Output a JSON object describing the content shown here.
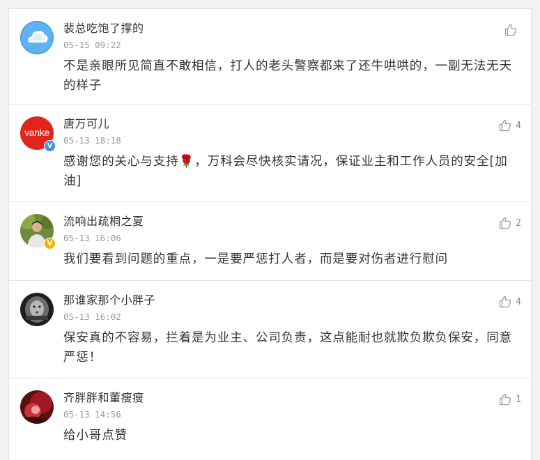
{
  "comments": [
    {
      "username": "裴总吃饱了撑的",
      "time": "05-15 09:22",
      "text": "不是亲眼所见简直不敢相信，打人的老头警察都来了还牛哄哄的，一副无法无天的样子",
      "likes": "",
      "avatar": "cloud-avatar",
      "verified": false
    },
    {
      "username": "唐万可儿",
      "time": "05-13 18:18",
      "text": "感谢您的关心与支持🌹，万科会尽快核实请况，保证业主和工作人员的安全[加油]",
      "likes": "4",
      "avatar": "vanke-logo-avatar",
      "avatar_text": "vanke",
      "verified": true,
      "verified_color": "#3f8ee8"
    },
    {
      "username": "流响出疏桐之夏",
      "time": "05-13 16:06",
      "text": "我们要看到问题的重点，一是要严惩打人者，而是要对伤者进行慰问",
      "likes": "2",
      "avatar": "person-photo-avatar",
      "verified": true,
      "verified_color": "#f5b400"
    },
    {
      "username": "那谁家那个小胖子",
      "time": "05-13 16:02",
      "text": "保安真的不容易，拦着是为业主、公司负责，这点能耐也就欺负欺负保安，同意严惩！",
      "likes": "4",
      "avatar": "lion-photo-avatar",
      "verified": false
    },
    {
      "username": "齐胖胖和董瘦瘦",
      "time": "05-13 14:56",
      "text": "给小哥点赞",
      "likes": "1",
      "avatar": "red-photo-avatar",
      "verified": false
    }
  ],
  "icons": {
    "like": "thumbs-up-icon",
    "verified": "verified-badge-icon"
  },
  "colors": {
    "text": "#333333",
    "meta": "#9a9a9a",
    "vanke_red": "#e0251b"
  }
}
